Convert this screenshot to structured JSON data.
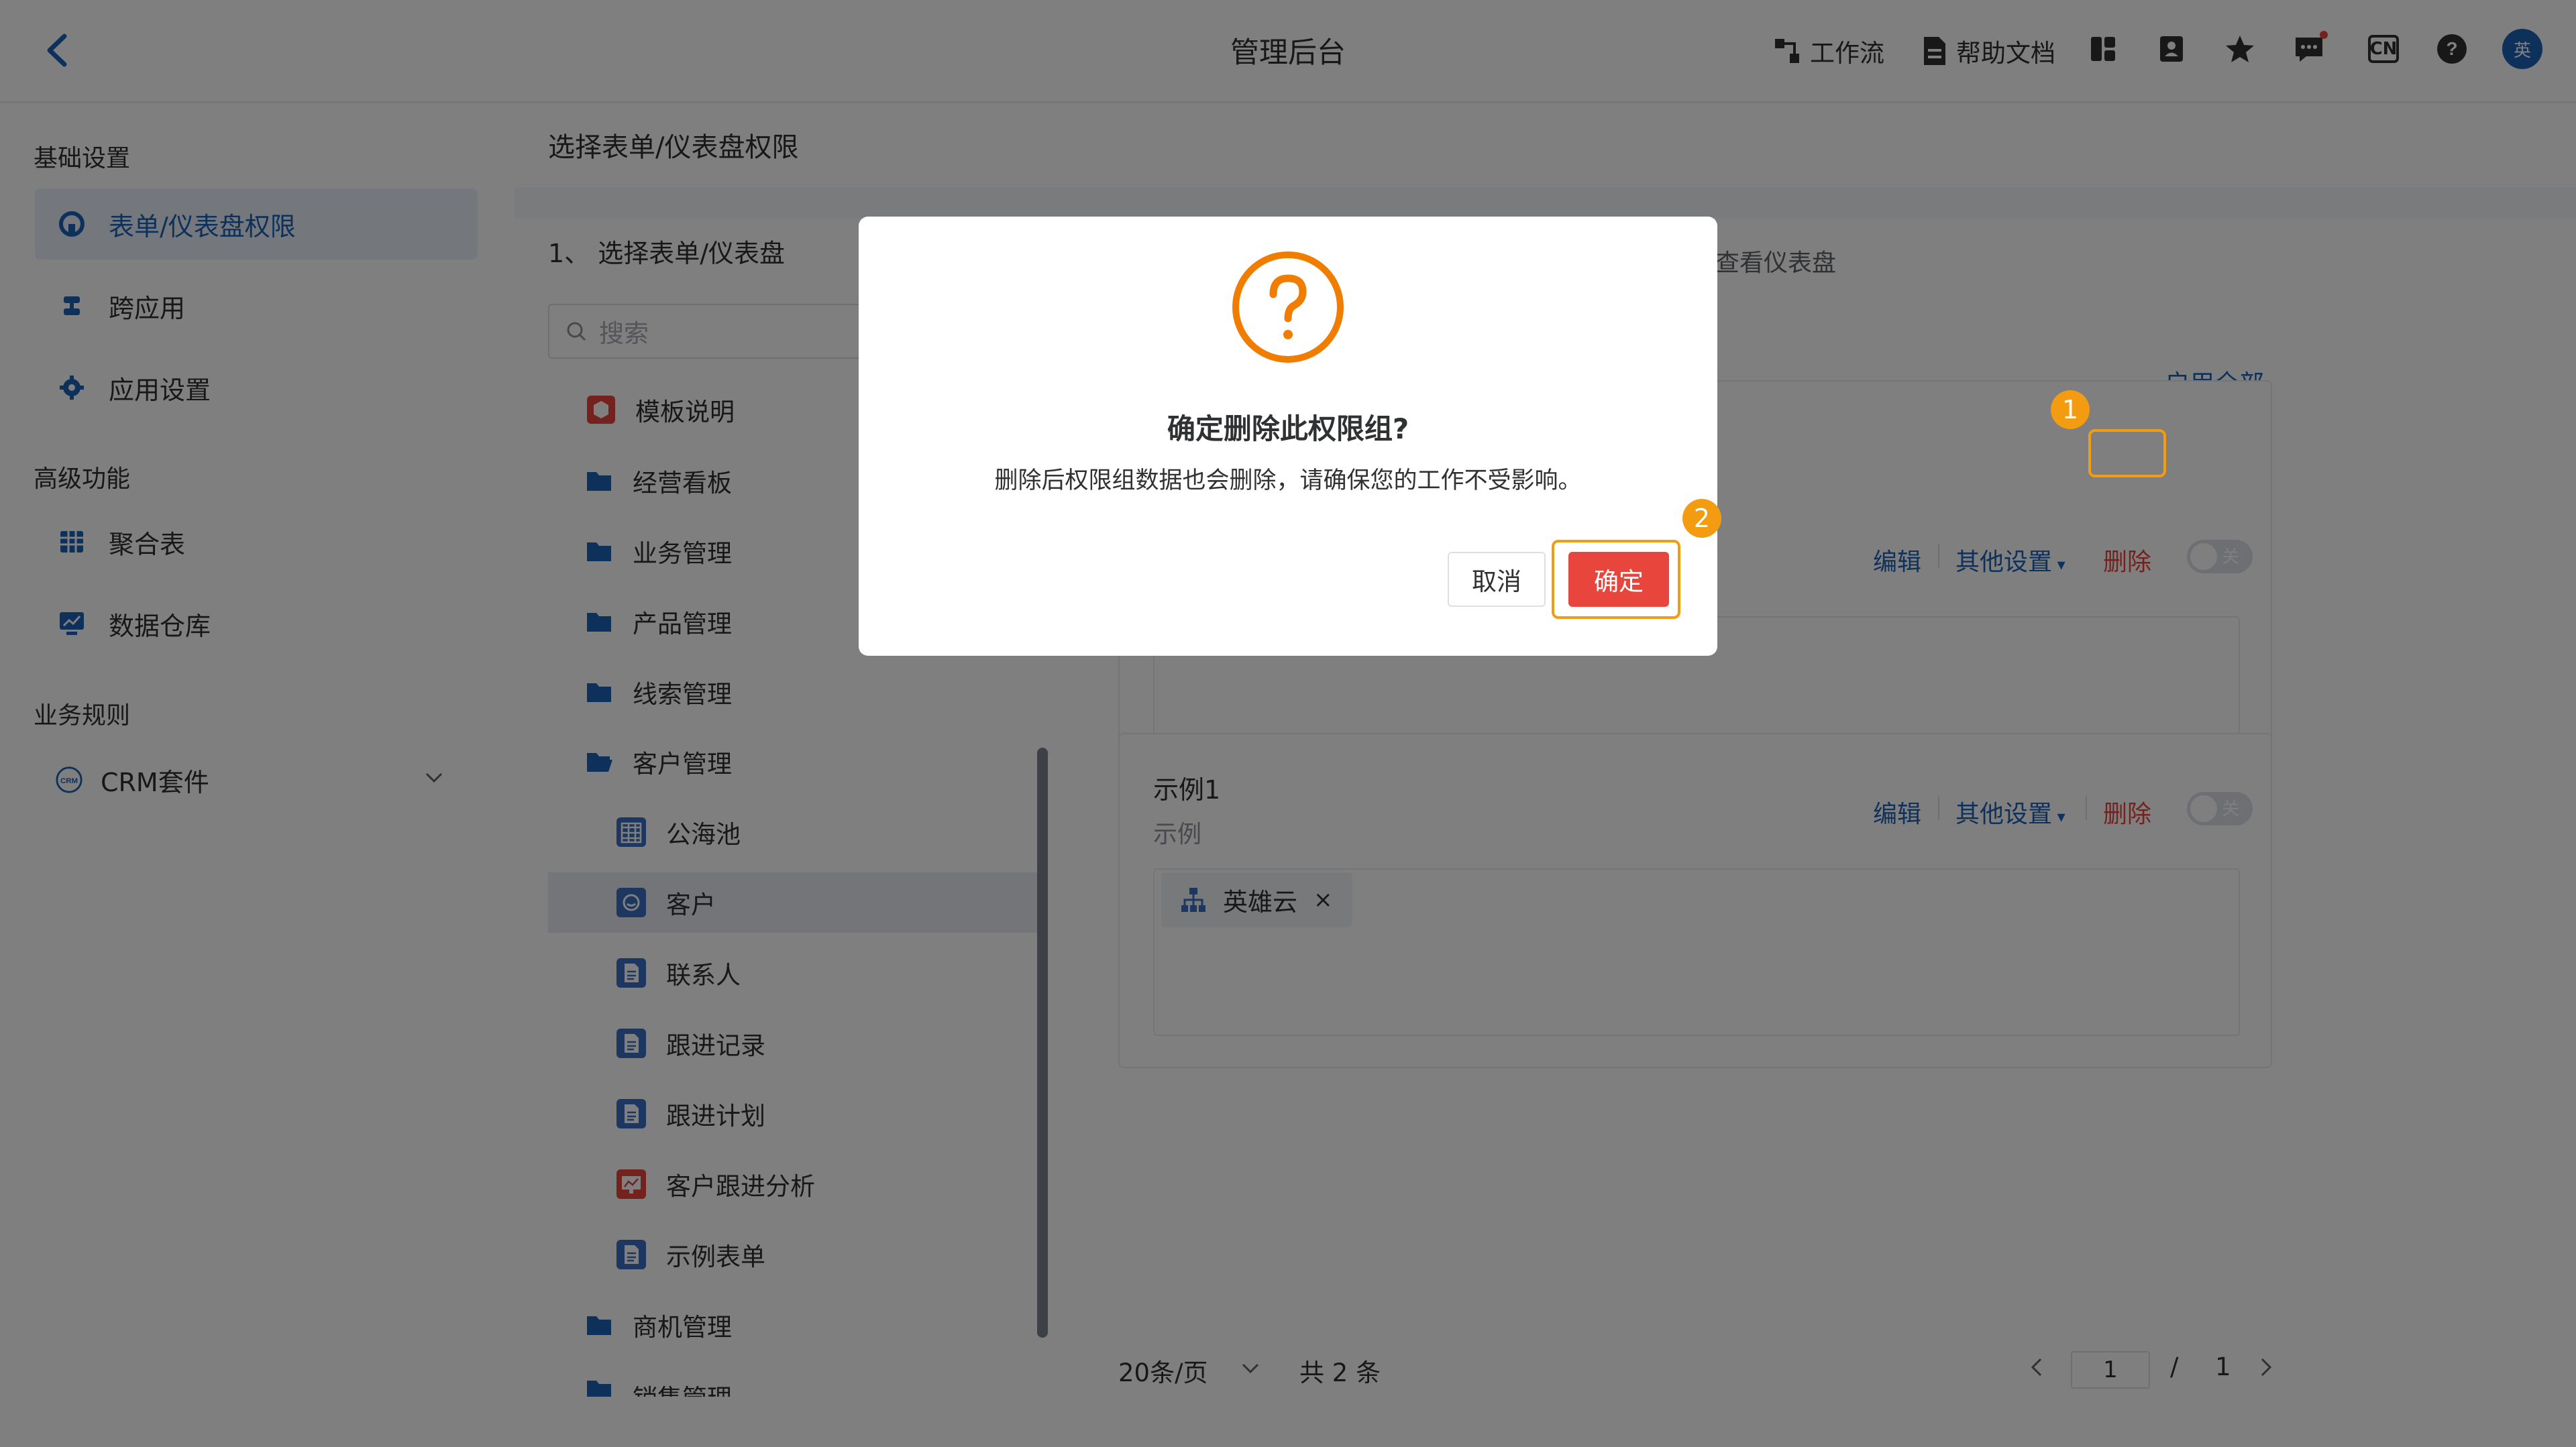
{
  "header": {
    "title": "管理后台",
    "workflow_label": "工作流",
    "docs_label": "帮助文档",
    "avatar_text": "英",
    "lang_text": "CN"
  },
  "sidebar": {
    "section_basic": "基础设置",
    "basic_items": [
      {
        "label": "表单/仪表盘权限",
        "icon": "rocket-icon"
      },
      {
        "label": "跨应用",
        "icon": "link-icon"
      },
      {
        "label": "应用设置",
        "icon": "gear-icon"
      }
    ],
    "section_advanced": "高级功能",
    "advanced_items": [
      {
        "label": "聚合表",
        "icon": "table-icon"
      },
      {
        "label": "数据仓库",
        "icon": "monitor-chart-icon"
      }
    ],
    "section_rules": "业务规则",
    "rules_items": [
      {
        "label": "CRM套件",
        "icon": "crm-icon"
      }
    ]
  },
  "page": {
    "title": "选择表单/仪表盘权限"
  },
  "left_panel": {
    "heading": "1、 选择表单/仪表盘",
    "search_placeholder": "搜索",
    "tree": [
      {
        "label": "模板说明",
        "icon": "cube-icon"
      },
      {
        "label": "经营看板",
        "icon": "folder-icon"
      },
      {
        "label": "业务管理",
        "icon": "folder-icon"
      },
      {
        "label": "产品管理",
        "icon": "folder-icon"
      },
      {
        "label": "线索管理",
        "icon": "folder-icon"
      },
      {
        "label": "客户管理",
        "icon": "folder-open-icon"
      },
      {
        "label": "公海池",
        "icon": "table-icon"
      },
      {
        "label": "客户",
        "icon": "customer-icon"
      },
      {
        "label": "联系人",
        "icon": "form-icon"
      },
      {
        "label": "跟进记录",
        "icon": "form-icon"
      },
      {
        "label": "跟进计划",
        "icon": "form-icon"
      },
      {
        "label": "客户跟进分析",
        "icon": "chart-icon"
      },
      {
        "label": "示例表单",
        "icon": "form-icon"
      },
      {
        "label": "商机管理",
        "icon": "folder-icon"
      },
      {
        "label": "销售管理",
        "icon": "folder-icon"
      }
    ]
  },
  "right_panel": {
    "partial_heading": "查看仪表盘",
    "enable_all": "启用全部",
    "group1": {
      "edit": "编辑",
      "other": "其他设置",
      "delete": "删除",
      "toggle": "关"
    },
    "group2": {
      "name": "示例1",
      "desc": "示例",
      "edit": "编辑",
      "other": "其他设置",
      "delete": "删除",
      "toggle": "关",
      "member": "英雄云"
    },
    "pager": {
      "page_size": "20条/页",
      "total": "共 2 条",
      "current": "1",
      "slash": "/",
      "pages": "1"
    }
  },
  "modal": {
    "title": "确定删除此权限组?",
    "message": "删除后权限组数据也会删除，请确保您的工作不受影响。",
    "cancel": "取消",
    "confirm": "确定"
  },
  "markers": {
    "one": "1",
    "two": "2"
  },
  "colors": {
    "accent": "#1d63b8",
    "danger": "#e8453c",
    "highlight": "#f39c12"
  }
}
